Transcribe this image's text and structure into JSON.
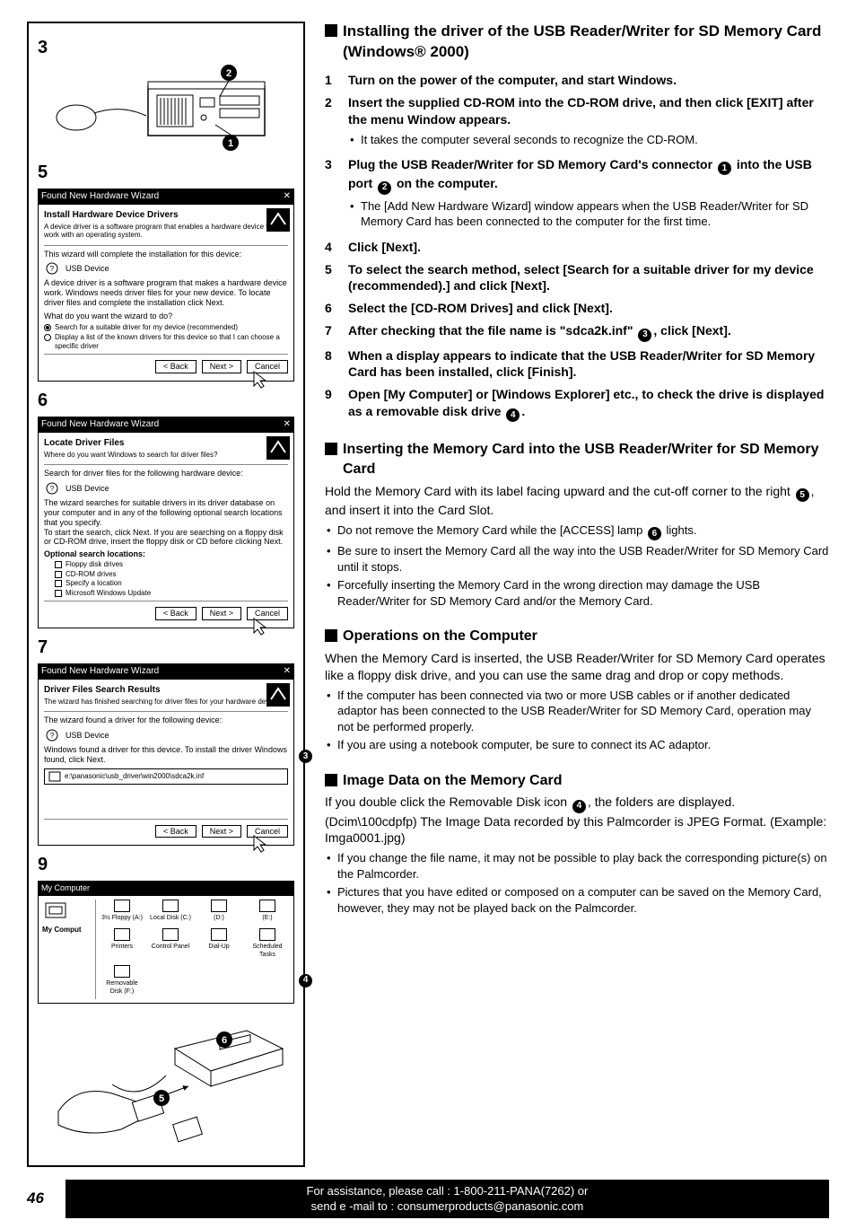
{
  "page_number": "46",
  "footer_line1": "For assistance, please call : 1-800-211-PANA(7262) or",
  "footer_line2": "send e -mail to : consumerproducts@panasonic.com",
  "left": {
    "fig3": "3",
    "fig5": "5",
    "fig6": "6",
    "fig7": "7",
    "fig9": "9",
    "wiz5": {
      "title": "Found New Hardware Wizard",
      "heading": "Install Hardware Device Drivers",
      "sub": "A device driver is a software program that enables a hardware device to work with an operating system.",
      "line1": "This wizard will complete the installation for this device:",
      "usb": "USB Device",
      "line2": "A device driver is a software program that makes a hardware device work. Windows needs driver files for your new device. To locate driver files and complete the installation click Next.",
      "q": "What do you want the wizard to do?",
      "r1": "Search for a suitable driver for my device (recommended)",
      "r2": "Display a list of the known drivers for this device so that I can choose a specific driver",
      "back": "< Back",
      "next": "Next >",
      "cancel": "Cancel"
    },
    "wiz6": {
      "title": "Found New Hardware Wizard",
      "heading": "Locate Driver Files",
      "sub": "Where do you want Windows to search for driver files?",
      "line1": "Search for driver files for the following hardware device:",
      "usb": "USB Device",
      "line2": "The wizard searches for suitable drivers in its driver database on your computer and in any of the following optional search locations that you specify.",
      "line3": "To start the search, click Next. If you are searching on a floppy disk or CD-ROM drive, insert the floppy disk or CD before clicking Next.",
      "opt": "Optional search locations:",
      "cb1": "Floppy disk drives",
      "cb2": "CD-ROM drives",
      "cb3": "Specify a location",
      "cb4": "Microsoft Windows Update",
      "back": "< Back",
      "next": "Next >",
      "cancel": "Cancel"
    },
    "wiz7": {
      "title": "Found New Hardware Wizard",
      "heading": "Driver Files Search Results",
      "sub": "The wizard has finished searching for driver files for your hardware device.",
      "line1": "The wizard found a driver for the following device:",
      "usb": "USB Device",
      "line2": "Windows found a driver for this device. To install the driver Windows found, click Next.",
      "file": "e:\\panasonic\\usb_driver\\win2000\\sdca2k.inf",
      "back": "< Back",
      "next": "Next >",
      "cancel": "Cancel"
    },
    "explorer": {
      "title": "My Computer",
      "myc": "My Comput",
      "items": [
        "3½ Floppy (A:)",
        "Local Disk (C:)",
        "(D:)",
        "(E:)",
        "Printers",
        "Control Panel",
        "Dial-Up",
        "Scheduled Tasks",
        "Removable Disk (F:)"
      ]
    }
  },
  "sec1": {
    "title": "Installing the driver of the USB Reader/Writer for SD Memory Card (Windows® 2000)",
    "steps": [
      {
        "n": "1",
        "t": "Turn on the power of the computer, and start Windows."
      },
      {
        "n": "2",
        "t": "Insert the supplied CD-ROM into the CD-ROM drive, and then click [EXIT] after the menu Window appears.",
        "bul": [
          "It takes the computer several seconds to recognize the CD-ROM."
        ]
      },
      {
        "n": "3",
        "t_pre": "Plug the USB Reader/Writer for SD Memory Card's connector ",
        "c1": "1",
        "t_mid": " into the USB port ",
        "c2": "2",
        "t_post": " on the computer.",
        "bul": [
          "The [Add New Hardware Wizard] window appears when the USB Reader/Writer for SD Memory Card has been connected to the computer for the first time."
        ]
      },
      {
        "n": "4",
        "t": "Click [Next]."
      },
      {
        "n": "5",
        "t": "To select the search method, select [Search for a suitable driver for my device (recommended).] and click [Next]."
      },
      {
        "n": "6",
        "t": "Select the [CD-ROM Drives] and click [Next]."
      },
      {
        "n": "7",
        "t_pre": "After checking that the file name is \"sdca2k.inf\" ",
        "c1": "3",
        "t_post": ", click [Next]."
      },
      {
        "n": "8",
        "t": "When a display appears to indicate that the USB Reader/Writer for SD Memory Card has been installed, click [Finish]."
      },
      {
        "n": "9",
        "t_pre": "Open [My Computer] or [Windows Explorer] etc., to check the drive is displayed as a removable disk drive ",
        "c1": "4",
        "t_post": "."
      }
    ]
  },
  "sec2": {
    "title": "Inserting the Memory Card into the USB Reader/Writer for SD Memory Card",
    "para_pre": "Hold the Memory Card with its label facing upward and the cut-off corner to the right ",
    "c1": "5",
    "para_post": ", and insert it into the Card Slot.",
    "bul": [
      {
        "pre": "Do not remove the Memory Card while the [ACCESS] lamp ",
        "c": "6",
        "post": " lights."
      },
      {
        "t": "Be sure to insert the Memory Card all the way into the USB Reader/Writer for SD Memory Card until it stops."
      },
      {
        "t": "Forcefully inserting the Memory Card in the wrong direction may damage the USB Reader/Writer for SD Memory Card and/or the Memory Card."
      }
    ]
  },
  "sec3": {
    "title": "Operations on the Computer",
    "para": "When the Memory Card is inserted, the USB Reader/Writer for SD Memory Card operates like a floppy disk drive, and you can use the same drag and drop or copy methods.",
    "bul": [
      "If the computer has been connected via two or more USB cables or if another dedicated adaptor has been connected to the USB Reader/Writer for SD Memory Card, operation may not be performed properly.",
      "If you are using a notebook computer, be sure to connect its AC adaptor."
    ]
  },
  "sec4": {
    "title": "Image Data on the Memory Card",
    "para_pre": "If you double click the Removable Disk icon ",
    "c1": "4",
    "para_post": ", the folders are displayed. (Dcim\\100cdpfp) The Image Data recorded by this Palmcorder is JPEG Format. (Example: Imga0001.jpg)",
    "bul": [
      "If you change the file name, it may not be possible to play back the corresponding picture(s) on the Palmcorder.",
      "Pictures that you have edited or composed on a computer can be saved on the Memory Card, however, they may not be played back on the Palmcorder."
    ]
  }
}
